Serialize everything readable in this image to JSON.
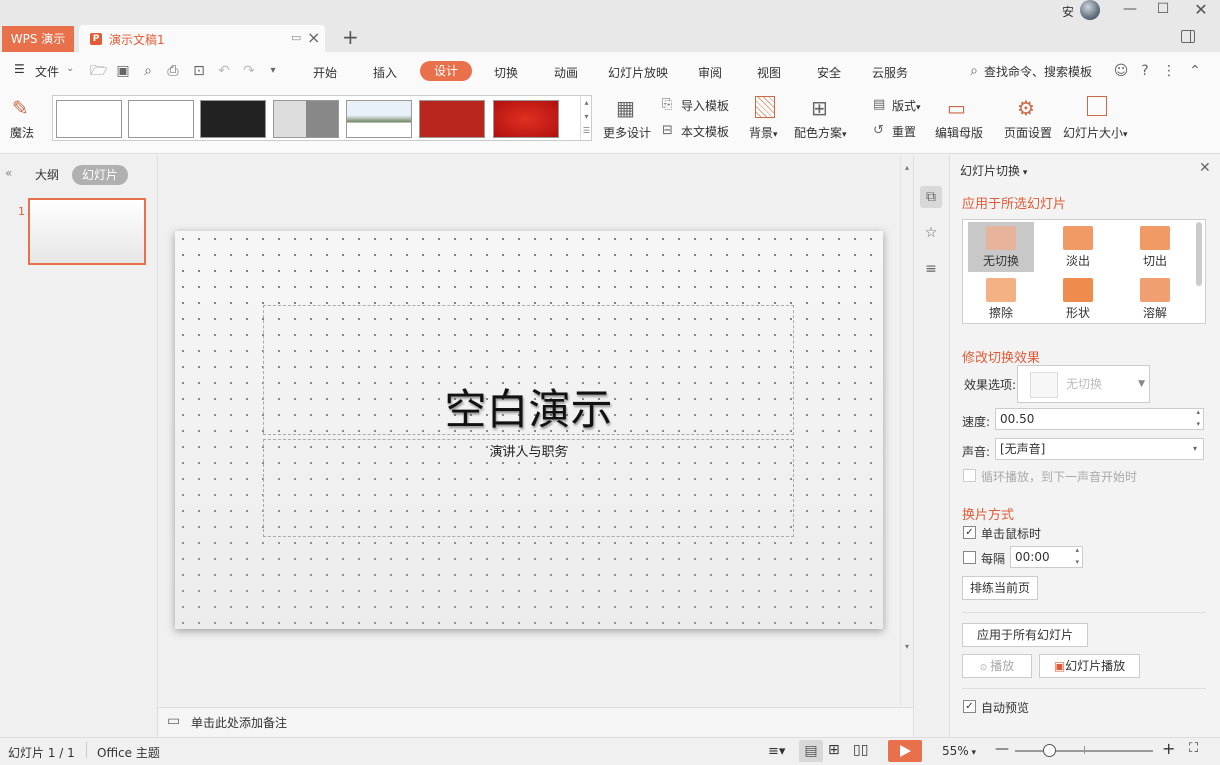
{
  "titlebar": {
    "wps_tab": "WPS 演示",
    "doc_tab": "演示文稿1",
    "doc_icon": "P",
    "user": "安",
    "new_tab": "+"
  },
  "menu": {
    "file": "文件",
    "tabs": [
      "开始",
      "插入",
      "设计",
      "切换",
      "动画",
      "幻灯片放映",
      "审阅",
      "视图",
      "安全",
      "云服务"
    ],
    "active_tab": "设计",
    "search": "查找命令、搜索模板"
  },
  "ribbon": {
    "magic": "魔法",
    "more_design": "更多设计",
    "import_template": "导入模板",
    "this_template": "本文模板",
    "background": "背景",
    "color_scheme": "配色方案",
    "layout": "版式",
    "reset": "重置",
    "edit_master": "编辑母版",
    "page_setup": "页面设置",
    "slide_size": "幻灯片大小"
  },
  "left_panel": {
    "outline_tab": "大纲",
    "slides_tab": "幻灯片",
    "slide_number": "1"
  },
  "slide": {
    "title": "空白演示",
    "subtitle": "演讲人与职务"
  },
  "notes": {
    "placeholder": "单击此处添加备注"
  },
  "transition_pane": {
    "header": "幻灯片切换",
    "apply_to_selected": "应用于所选幻灯片",
    "transitions": [
      {
        "label": "无切换",
        "color": "#e7b49b"
      },
      {
        "label": "淡出",
        "color": "#f19a66"
      },
      {
        "label": "切出",
        "color": "#f19a66"
      },
      {
        "label": "擦除",
        "color": "#f4b184"
      },
      {
        "label": "形状",
        "color": "#f08b4e"
      },
      {
        "label": "溶解",
        "color": "#f0a070"
      }
    ],
    "modify_effect": "修改切换效果",
    "effect_options_label": "效果选项:",
    "effect_options_value": "无切换",
    "speed_label": "速度:",
    "speed_value": "00.50",
    "sound_label": "声音:",
    "sound_value": "[无声音]",
    "loop_label": "循环播放，到下一声音开始时",
    "advance_section": "换片方式",
    "on_click_label": "单击鼠标时",
    "every_label": "每隔",
    "every_value": "00:00",
    "rehearse_button": "排练当前页",
    "apply_all_button": "应用于所有幻灯片",
    "play_button": "播放",
    "slideshow_button": "幻灯片播放",
    "auto_preview_label": "自动预览"
  },
  "statusbar": {
    "slide_count": "幻灯片 1 / 1",
    "theme": "Office 主题",
    "zoom": "55%",
    "zoom_level": 0.25
  },
  "colors": {
    "accent": "#e8704a",
    "accent_text": "#e05b37"
  }
}
